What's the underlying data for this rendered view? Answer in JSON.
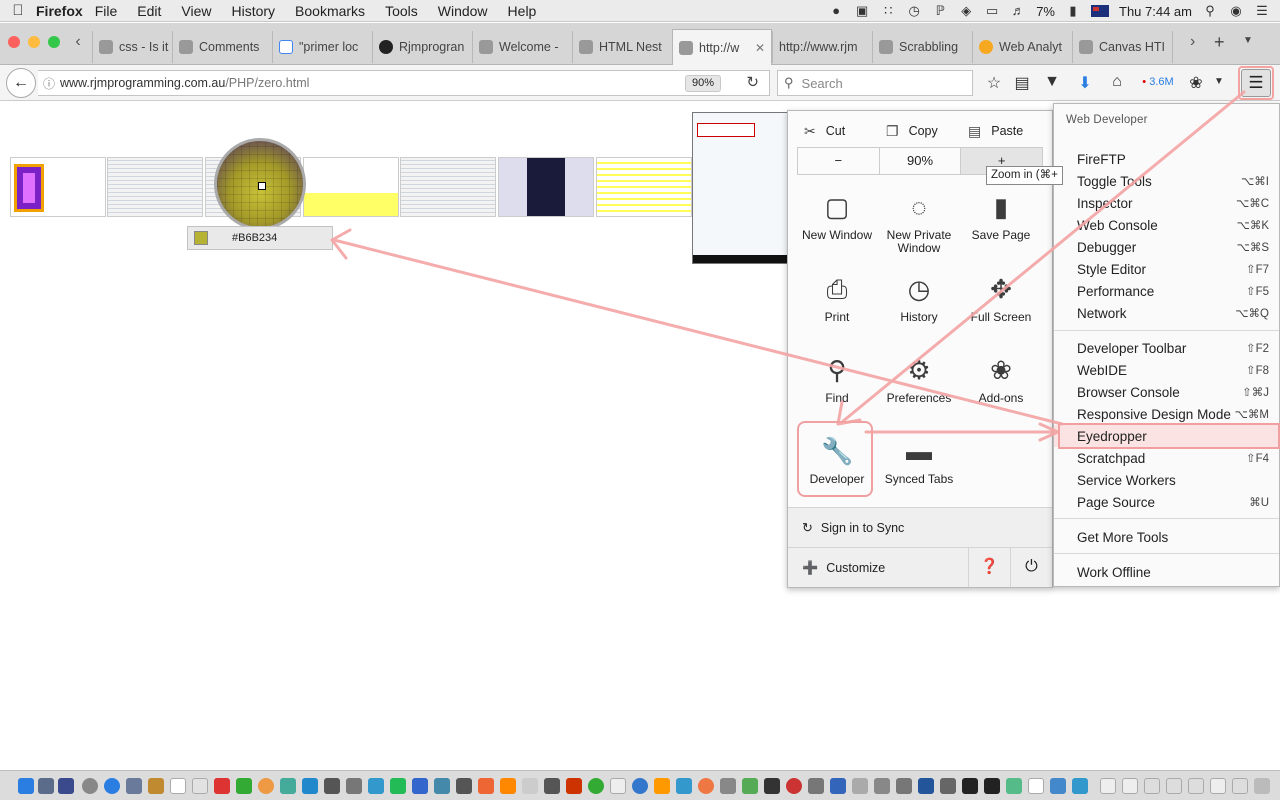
{
  "menubar": {
    "app_name": "Firefox",
    "items": [
      "File",
      "Edit",
      "View",
      "History",
      "Bookmarks",
      "Tools",
      "Window",
      "Help"
    ],
    "battery": "7%",
    "clock": "Thu 7:44 am"
  },
  "tabs": [
    {
      "label": "css - Is it p",
      "left": 0
    },
    {
      "label": "Comments"
    },
    {
      "label": "\"primer loc"
    },
    {
      "label": "Rjmprogran"
    },
    {
      "label": "Welcome -"
    },
    {
      "label": "HTML Nest"
    },
    {
      "label": "http://w"
    },
    {
      "label": "http://www.rjm"
    },
    {
      "label": "Scrabbling"
    },
    {
      "label": "Web Analyt"
    },
    {
      "label": "Canvas HTI"
    }
  ],
  "navbar": {
    "url_host": "www.rjmprogramming.com.au",
    "url_path": "/PHP/zero.html",
    "zoom_badge": "90%",
    "search_placeholder": "Search",
    "download_count": "3.6M"
  },
  "page": {
    "eyedropper_hex": "#B6B234",
    "eyedropper_color": "#B6B234"
  },
  "panel": {
    "cut": "Cut",
    "copy": "Copy",
    "paste": "Paste",
    "zoom_out": "−",
    "zoom_level": "90%",
    "zoom_in": "+",
    "zoom_tooltip": "Zoom in (⌘+",
    "items": [
      {
        "label": "New Window",
        "icon": "window-icon"
      },
      {
        "label": "New Private Window",
        "icon": "mask-icon"
      },
      {
        "label": "Save Page",
        "icon": "document-icon"
      },
      {
        "label": "Print",
        "icon": "printer-icon"
      },
      {
        "label": "History",
        "icon": "clock-icon"
      },
      {
        "label": "Full Screen",
        "icon": "fullscreen-icon"
      },
      {
        "label": "Find",
        "icon": "magnifier-icon"
      },
      {
        "label": "Preferences",
        "icon": "gear-icon"
      },
      {
        "label": "Add-ons",
        "icon": "puzzle-icon"
      },
      {
        "label": "Developer",
        "icon": "wrench-icon"
      },
      {
        "label": "Synced Tabs",
        "icon": "synced-tabs-icon"
      }
    ],
    "sign_in": "Sign in to Sync",
    "customize": "Customize"
  },
  "devmenu": {
    "header": "Web Developer",
    "groups": [
      [
        {
          "label": "FireFTP",
          "shortcut": ""
        },
        {
          "label": "Toggle Tools",
          "shortcut": "⌥⌘I"
        },
        {
          "label": "Inspector",
          "shortcut": "⌥⌘C"
        },
        {
          "label": "Web Console",
          "shortcut": "⌥⌘K"
        },
        {
          "label": "Debugger",
          "shortcut": "⌥⌘S"
        },
        {
          "label": "Style Editor",
          "shortcut": "⇧F7"
        },
        {
          "label": "Performance",
          "shortcut": "⇧F5"
        },
        {
          "label": "Network",
          "shortcut": "⌥⌘Q"
        }
      ],
      [
        {
          "label": "Developer Toolbar",
          "shortcut": "⇧F2"
        },
        {
          "label": "WebIDE",
          "shortcut": "⇧F8"
        },
        {
          "label": "Browser Console",
          "shortcut": "⇧⌘J"
        },
        {
          "label": "Responsive Design Mode",
          "shortcut": "⌥⌘M"
        },
        {
          "label": "Eyedropper",
          "shortcut": ""
        },
        {
          "label": "Scratchpad",
          "shortcut": "⇧F4"
        },
        {
          "label": "Service Workers",
          "shortcut": ""
        },
        {
          "label": "Page Source",
          "shortcut": "⌘U"
        }
      ],
      [
        {
          "label": "Get More Tools",
          "shortcut": ""
        }
      ],
      [
        {
          "label": "Work Offline",
          "shortcut": ""
        }
      ]
    ]
  },
  "colors": {
    "annotation": "#f4a3a3",
    "eyedropper": "#B6B234"
  }
}
